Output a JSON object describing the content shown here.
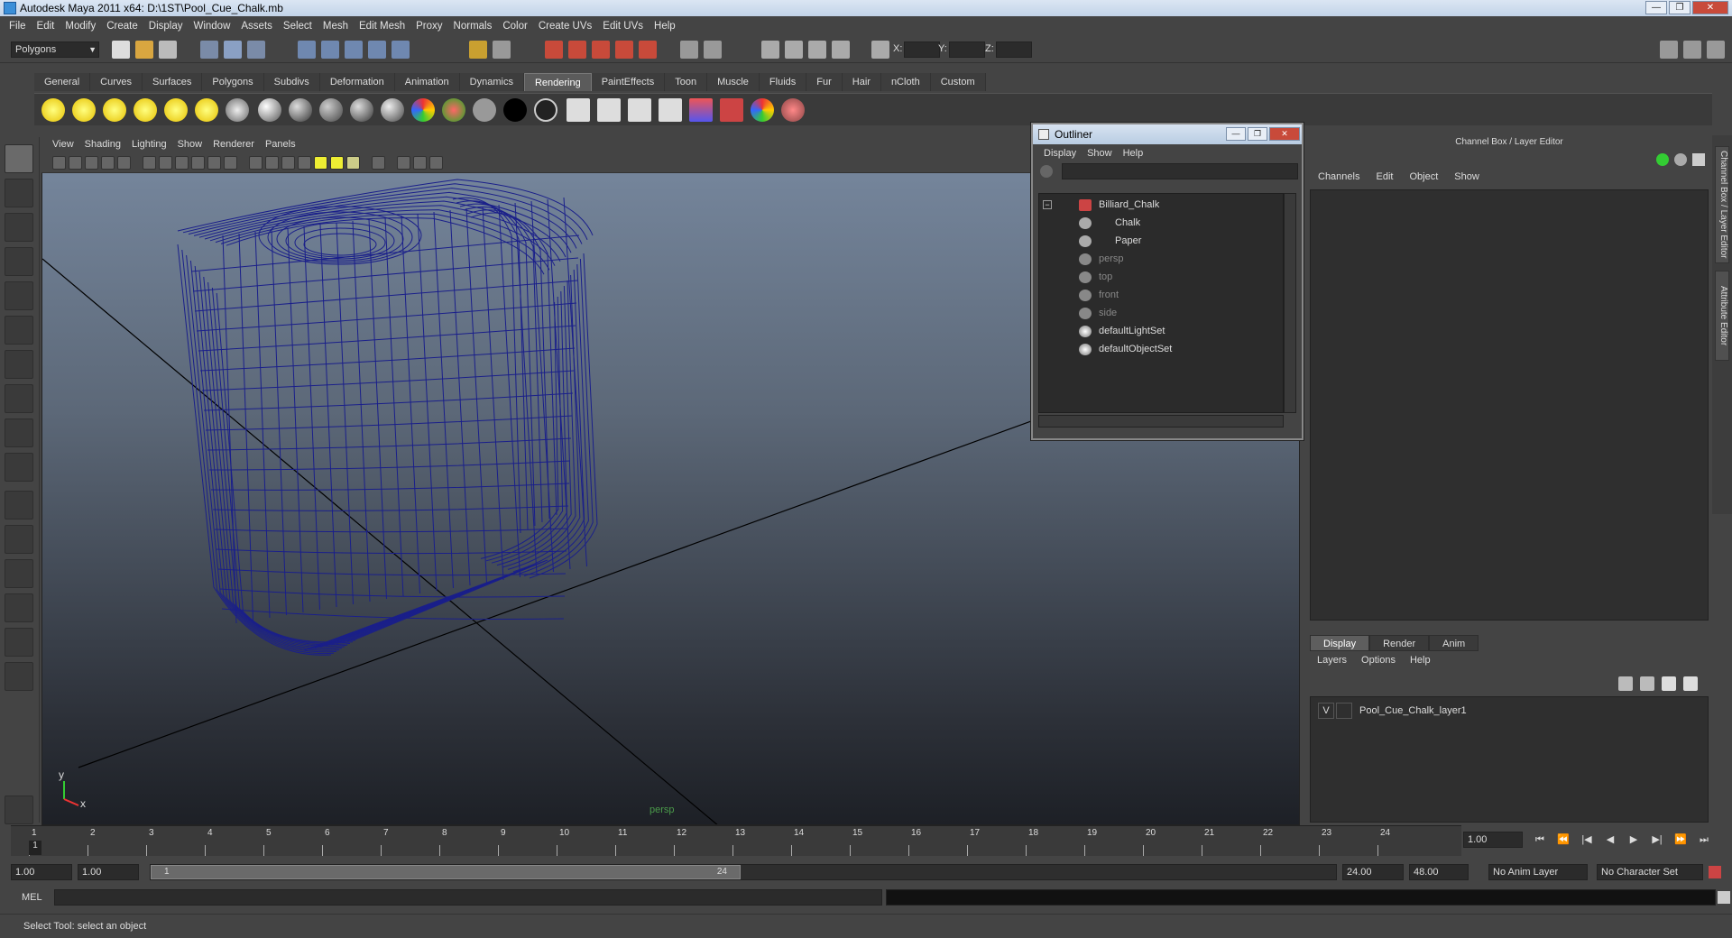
{
  "window": {
    "title": "Autodesk Maya 2011 x64: D:\\1ST\\Pool_Cue_Chalk.mb",
    "min": "—",
    "max": "❐",
    "close": "✕"
  },
  "menubar": [
    "File",
    "Edit",
    "Modify",
    "Create",
    "Display",
    "Window",
    "Assets",
    "Select",
    "Mesh",
    "Edit Mesh",
    "Proxy",
    "Normals",
    "Color",
    "Create UVs",
    "Edit UVs",
    "Help"
  ],
  "statusline": {
    "mode": "Polygons",
    "x_label": "X:",
    "y_label": "Y:",
    "z_label": "Z:"
  },
  "shelf_tabs": [
    "General",
    "Curves",
    "Surfaces",
    "Polygons",
    "Subdivs",
    "Deformation",
    "Animation",
    "Dynamics",
    "Rendering",
    "PaintEffects",
    "Toon",
    "Muscle",
    "Fluids",
    "Fur",
    "Hair",
    "nCloth",
    "Custom"
  ],
  "active_shelf_tab": "Rendering",
  "viewport": {
    "menu": [
      "View",
      "Shading",
      "Lighting",
      "Show",
      "Renderer",
      "Panels"
    ],
    "camera_label": "persp",
    "axis_y": "y",
    "axis_x": "x"
  },
  "outliner": {
    "title": "Outliner",
    "menu": [
      "Display",
      "Show",
      "Help"
    ],
    "items": [
      {
        "label": "Billiard_Chalk",
        "dim": false
      },
      {
        "label": "Chalk",
        "dim": false
      },
      {
        "label": "Paper",
        "dim": false
      },
      {
        "label": "persp",
        "dim": true
      },
      {
        "label": "top",
        "dim": true
      },
      {
        "label": "front",
        "dim": true
      },
      {
        "label": "side",
        "dim": true
      },
      {
        "label": "defaultLightSet",
        "dim": false
      },
      {
        "label": "defaultObjectSet",
        "dim": false
      }
    ],
    "expand": "−"
  },
  "channelbox": {
    "title": "Channel Box / Layer Editor",
    "menu": [
      "Channels",
      "Edit",
      "Object",
      "Show"
    ]
  },
  "side_tabs": [
    "Channel Box / Layer Editor",
    "Attribute Editor"
  ],
  "layer_editor": {
    "tabs": [
      "Display",
      "Render",
      "Anim"
    ],
    "active_tab": "Display",
    "menu": [
      "Layers",
      "Options",
      "Help"
    ],
    "layers": [
      {
        "visible": "V",
        "name": "Pool_Cue_Chalk_layer1"
      }
    ]
  },
  "timeline": {
    "ticks": [
      1,
      2,
      3,
      4,
      5,
      6,
      7,
      8,
      9,
      10,
      11,
      12,
      13,
      14,
      15,
      16,
      17,
      18,
      19,
      20,
      21,
      22,
      23,
      24
    ],
    "current_frame": "1.00",
    "current_marker": "1"
  },
  "playback": [
    "⏮",
    "⏪",
    "|◀",
    "◀",
    "▶",
    "▶|",
    "⏩",
    "⏭"
  ],
  "range": {
    "start": "1.00",
    "playback_start": "1.00",
    "slider_start": "1",
    "slider_end": "24",
    "playback_end": "24.00",
    "end": "48.00",
    "anim_layer": "No Anim Layer",
    "character_set": "No Character Set"
  },
  "mel_label": "MEL",
  "help_text": "Select Tool: select an object"
}
